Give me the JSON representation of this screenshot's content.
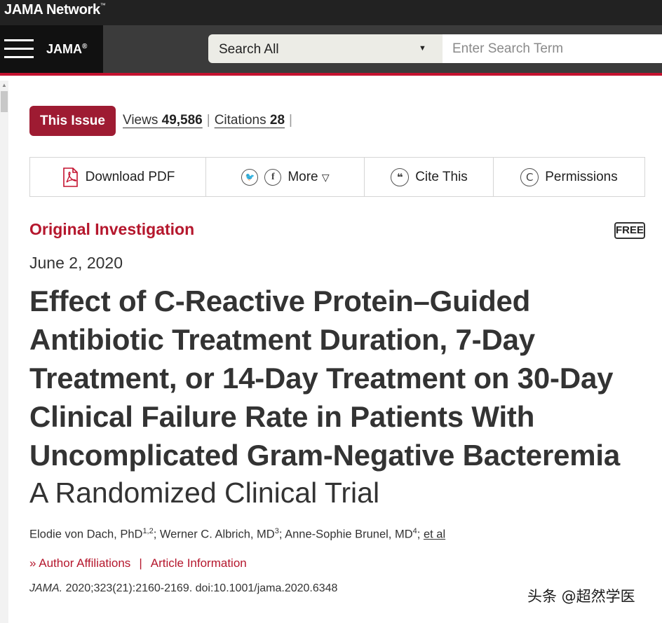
{
  "site": {
    "brand": "JAMA Network",
    "brand_mark": "™"
  },
  "nav": {
    "logo": "JAMA",
    "logo_mark": "®"
  },
  "search": {
    "scope": "Search All",
    "placeholder": "Enter Search Term"
  },
  "issue": {
    "button": "This Issue",
    "views_label": "Views",
    "views_value": "49,586",
    "citations_label": "Citations",
    "citations_value": "28",
    "sep": "|"
  },
  "toolbar": {
    "download": "Download PDF",
    "twitter_icon": "twitter-icon",
    "facebook_icon": "facebook-icon",
    "more": "More",
    "more_caret": "▽",
    "cite": "Cite This",
    "permissions": "Permissions"
  },
  "article": {
    "type": "Original Investigation",
    "badge": "FREE",
    "date": "June 2, 2020",
    "title": "Effect of C-Reactive Protein–Guided Antibiotic Treatment Duration, 7-Day Treatment, or 14-Day Treatment on 30-Day Clinical Failure Rate in Patients With Uncomplicated Gram-Negative Bacteremia",
    "subtitle": "A Randomized Clinical Trial",
    "authors": [
      {
        "name": "Elodie von Dach, PhD",
        "aff": "1,2"
      },
      {
        "name": "Werner C. Albrich, MD",
        "aff": "3"
      },
      {
        "name": "Anne-Sophie Brunel, MD",
        "aff": "4"
      }
    ],
    "et_al": "et al",
    "author_affiliations": "Author Affiliations",
    "article_information": "Article Information",
    "links_sep": "|",
    "citation_journal": "JAMA.",
    "citation_rest": " 2020;323(21):2160-2169. doi:10.1001/jama.2020.6348"
  },
  "watermark": "头条 @超然学医",
  "colors": {
    "accent": "#b5172d",
    "issue_button": "#9e1b32",
    "topbar": "#222222"
  }
}
